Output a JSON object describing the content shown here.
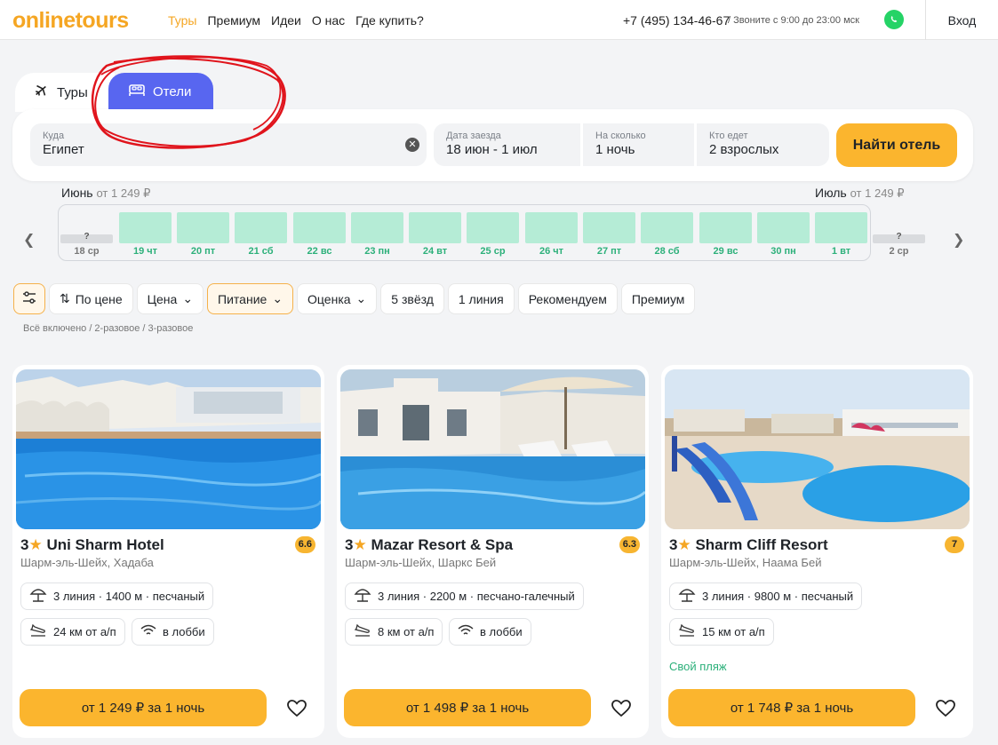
{
  "header": {
    "logo": "onlinetours",
    "nav": [
      "Туры",
      "Премиум",
      "Идеи",
      "О нас",
      "Где купить?"
    ],
    "phone": "+7 (495) 134-46-67",
    "hours": "/ Звоните с 9:00 до 23:00 мск",
    "login": "Вход"
  },
  "tabs": {
    "tours": "Туры",
    "hotels": "Отели"
  },
  "search": {
    "dest_label": "Куда",
    "dest_value": "Египет",
    "date_label": "Дата заезда",
    "date_value": "18 июн - 1 июл",
    "nights_label": "На сколько",
    "nights_value": "1 ночь",
    "guests_label": "Кто едет",
    "guests_value": "2 взрослых",
    "button": "Найти отель"
  },
  "calendar": {
    "month_left": "Июнь",
    "month_left_price": "от 1 249 ₽",
    "month_right": "Июль",
    "month_right_price": "от 1 249 ₽",
    "days": [
      {
        "label": "18 ср",
        "q": "?"
      },
      {
        "label": "19 чт"
      },
      {
        "label": "20 пт"
      },
      {
        "label": "21 сб"
      },
      {
        "label": "22 вс"
      },
      {
        "label": "23 пн"
      },
      {
        "label": "24 вт"
      },
      {
        "label": "25 ср"
      },
      {
        "label": "26 чт"
      },
      {
        "label": "27 пт"
      },
      {
        "label": "28 сб"
      },
      {
        "label": "29 вс"
      },
      {
        "label": "30 пн"
      },
      {
        "label": "1 вт"
      },
      {
        "label": "2 ср",
        "q": "?"
      }
    ]
  },
  "filters": {
    "sort": "По цене",
    "price": "Цена",
    "food": "Питание",
    "score": "Оценка",
    "stars": "5 звёзд",
    "line": "1 линия",
    "recommended": "Рекомендуем",
    "premium": "Премиум",
    "food_note": "Всё включено / 2-разовое / 3-разовое"
  },
  "cards": [
    {
      "stars": "3",
      "name": "Uni Sharm Hotel",
      "rating": "6.6",
      "location": "Шарм-эль-Шейх, Хадаба",
      "beach": "3 линия · 1400 м · песчаный",
      "airport": "24 км от а/п",
      "wifi": "в лобби",
      "price": "от 1 249 ₽ за 1 ночь"
    },
    {
      "stars": "3",
      "name": "Mazar Resort & Spa",
      "rating": "6.3",
      "location": "Шарм-эль-Шейх, Шаркс Бей",
      "beach": "3 линия · 2200 м · песчано-галечный",
      "airport": "8 км от а/п",
      "wifi": "в лобби",
      "price": "от 1 498 ₽ за 1 ночь"
    },
    {
      "stars": "3",
      "name": "Sharm Cliff Resort",
      "rating": "7",
      "location": "Шарм-эль-Шейх, Наама Бей",
      "beach": "3 линия · 9800 м · песчаный",
      "airport": "15 км от а/п",
      "extra": "Свой пляж",
      "price": "от 1 748 ₽ за 1 ночь"
    }
  ]
}
